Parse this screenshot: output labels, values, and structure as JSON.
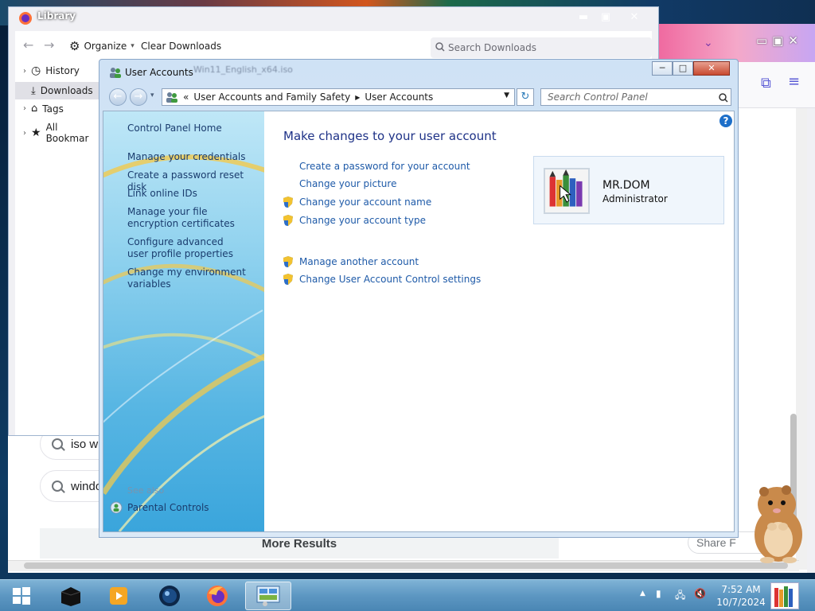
{
  "library": {
    "title": "Library",
    "organize_label": "Organize",
    "clear_downloads_label": "Clear Downloads",
    "search_placeholder": "Search Downloads",
    "nav": [
      {
        "label": "History"
      },
      {
        "label": "Downloads"
      },
      {
        "label": "Tags"
      },
      {
        "label": "All Bookmar"
      }
    ]
  },
  "browser": {
    "suggestions": [
      "iso wi",
      "windo"
    ],
    "more_results_label": "More Results",
    "share_label": "Share F"
  },
  "user_accounts": {
    "window_title": "User Accounts",
    "bleed_text": "Win11_English_x64.iso",
    "breadcrumb": {
      "root_glyph": "«",
      "items": [
        "User Accounts and Family Safety",
        "User Accounts"
      ]
    },
    "search_placeholder": "Search Control Panel",
    "left_links": [
      "Control Panel Home",
      "Manage your credentials",
      "Create a password reset disk",
      "Link online IDs",
      "Manage your file encryption certificates",
      "Configure advanced user profile properties",
      "Change my environment variables"
    ],
    "see_also_label": "See also",
    "see_also_links": [
      "Parental Controls"
    ],
    "heading": "Make changes to your user account",
    "tasks": [
      {
        "label": "Create a password for your account",
        "shield": false
      },
      {
        "label": "Change your picture",
        "shield": false
      },
      {
        "label": "Change your account name",
        "shield": true
      },
      {
        "label": "Change your account type",
        "shield": true
      }
    ],
    "tasks2": [
      {
        "label": "Manage another account",
        "shield": true
      },
      {
        "label": "Change User Account Control settings",
        "shield": true
      }
    ],
    "account": {
      "name": "MR.DOM",
      "role": "Administrator"
    },
    "help_label": "?"
  },
  "taskbar": {
    "time": "7:52 AM",
    "date": "10/7/2024"
  },
  "colors": {
    "link_blue": "#1e5aa8",
    "heading_blue": "#1e3287",
    "taskbar": "#5d97c2"
  }
}
